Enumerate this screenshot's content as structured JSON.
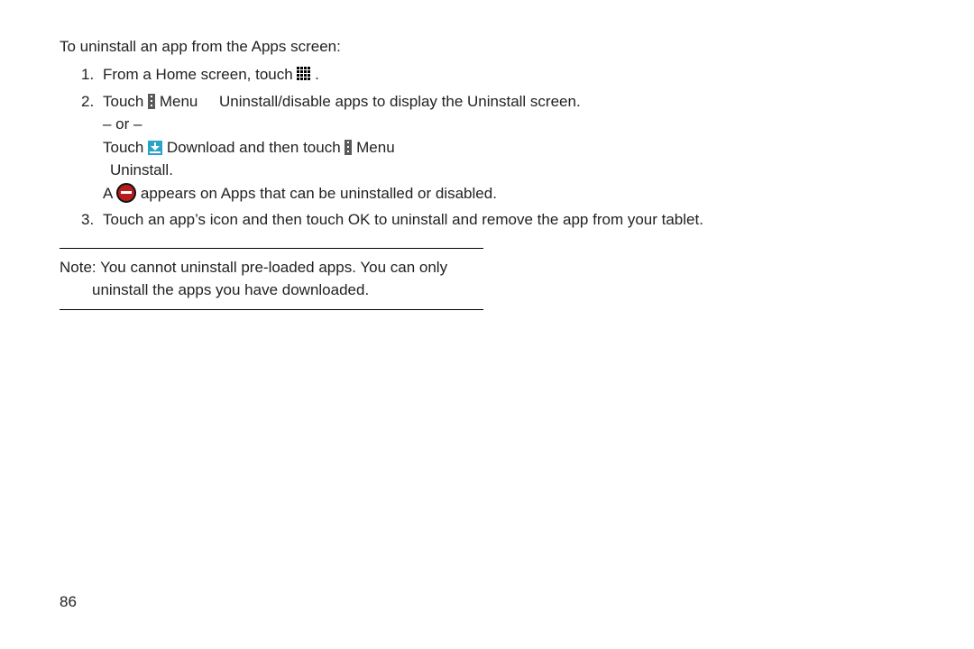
{
  "intro": "To uninstall an app from the Apps screen:",
  "steps": {
    "s1_a": "From a Home screen, touch ",
    "s1_b": " .",
    "s2_a": "Touch ",
    "s2_menu": " Menu",
    "s2_arrow_uninstall": "Uninstall/disable apps",
    "s2_b": " to display the Uninstall screen.",
    "s2_or": "– or –",
    "s2_c": "Touch ",
    "s2_download": " Download",
    "s2_d": " and then touch ",
    "s2_menu2": " Menu",
    "s2_uninstall_line": "Uninstall.",
    "s2_e_a": "A ",
    "s2_e_b": " appears on Apps that can be uninstalled or disabled.",
    "s3": "Touch an app’s icon and then touch OK to uninstall and remove the app from your tablet."
  },
  "note": {
    "label": "Note:",
    "body": "You cannot uninstall pre-loaded apps. You can only",
    "cont": "uninstall the apps you have downloaded."
  },
  "page_number": "86"
}
